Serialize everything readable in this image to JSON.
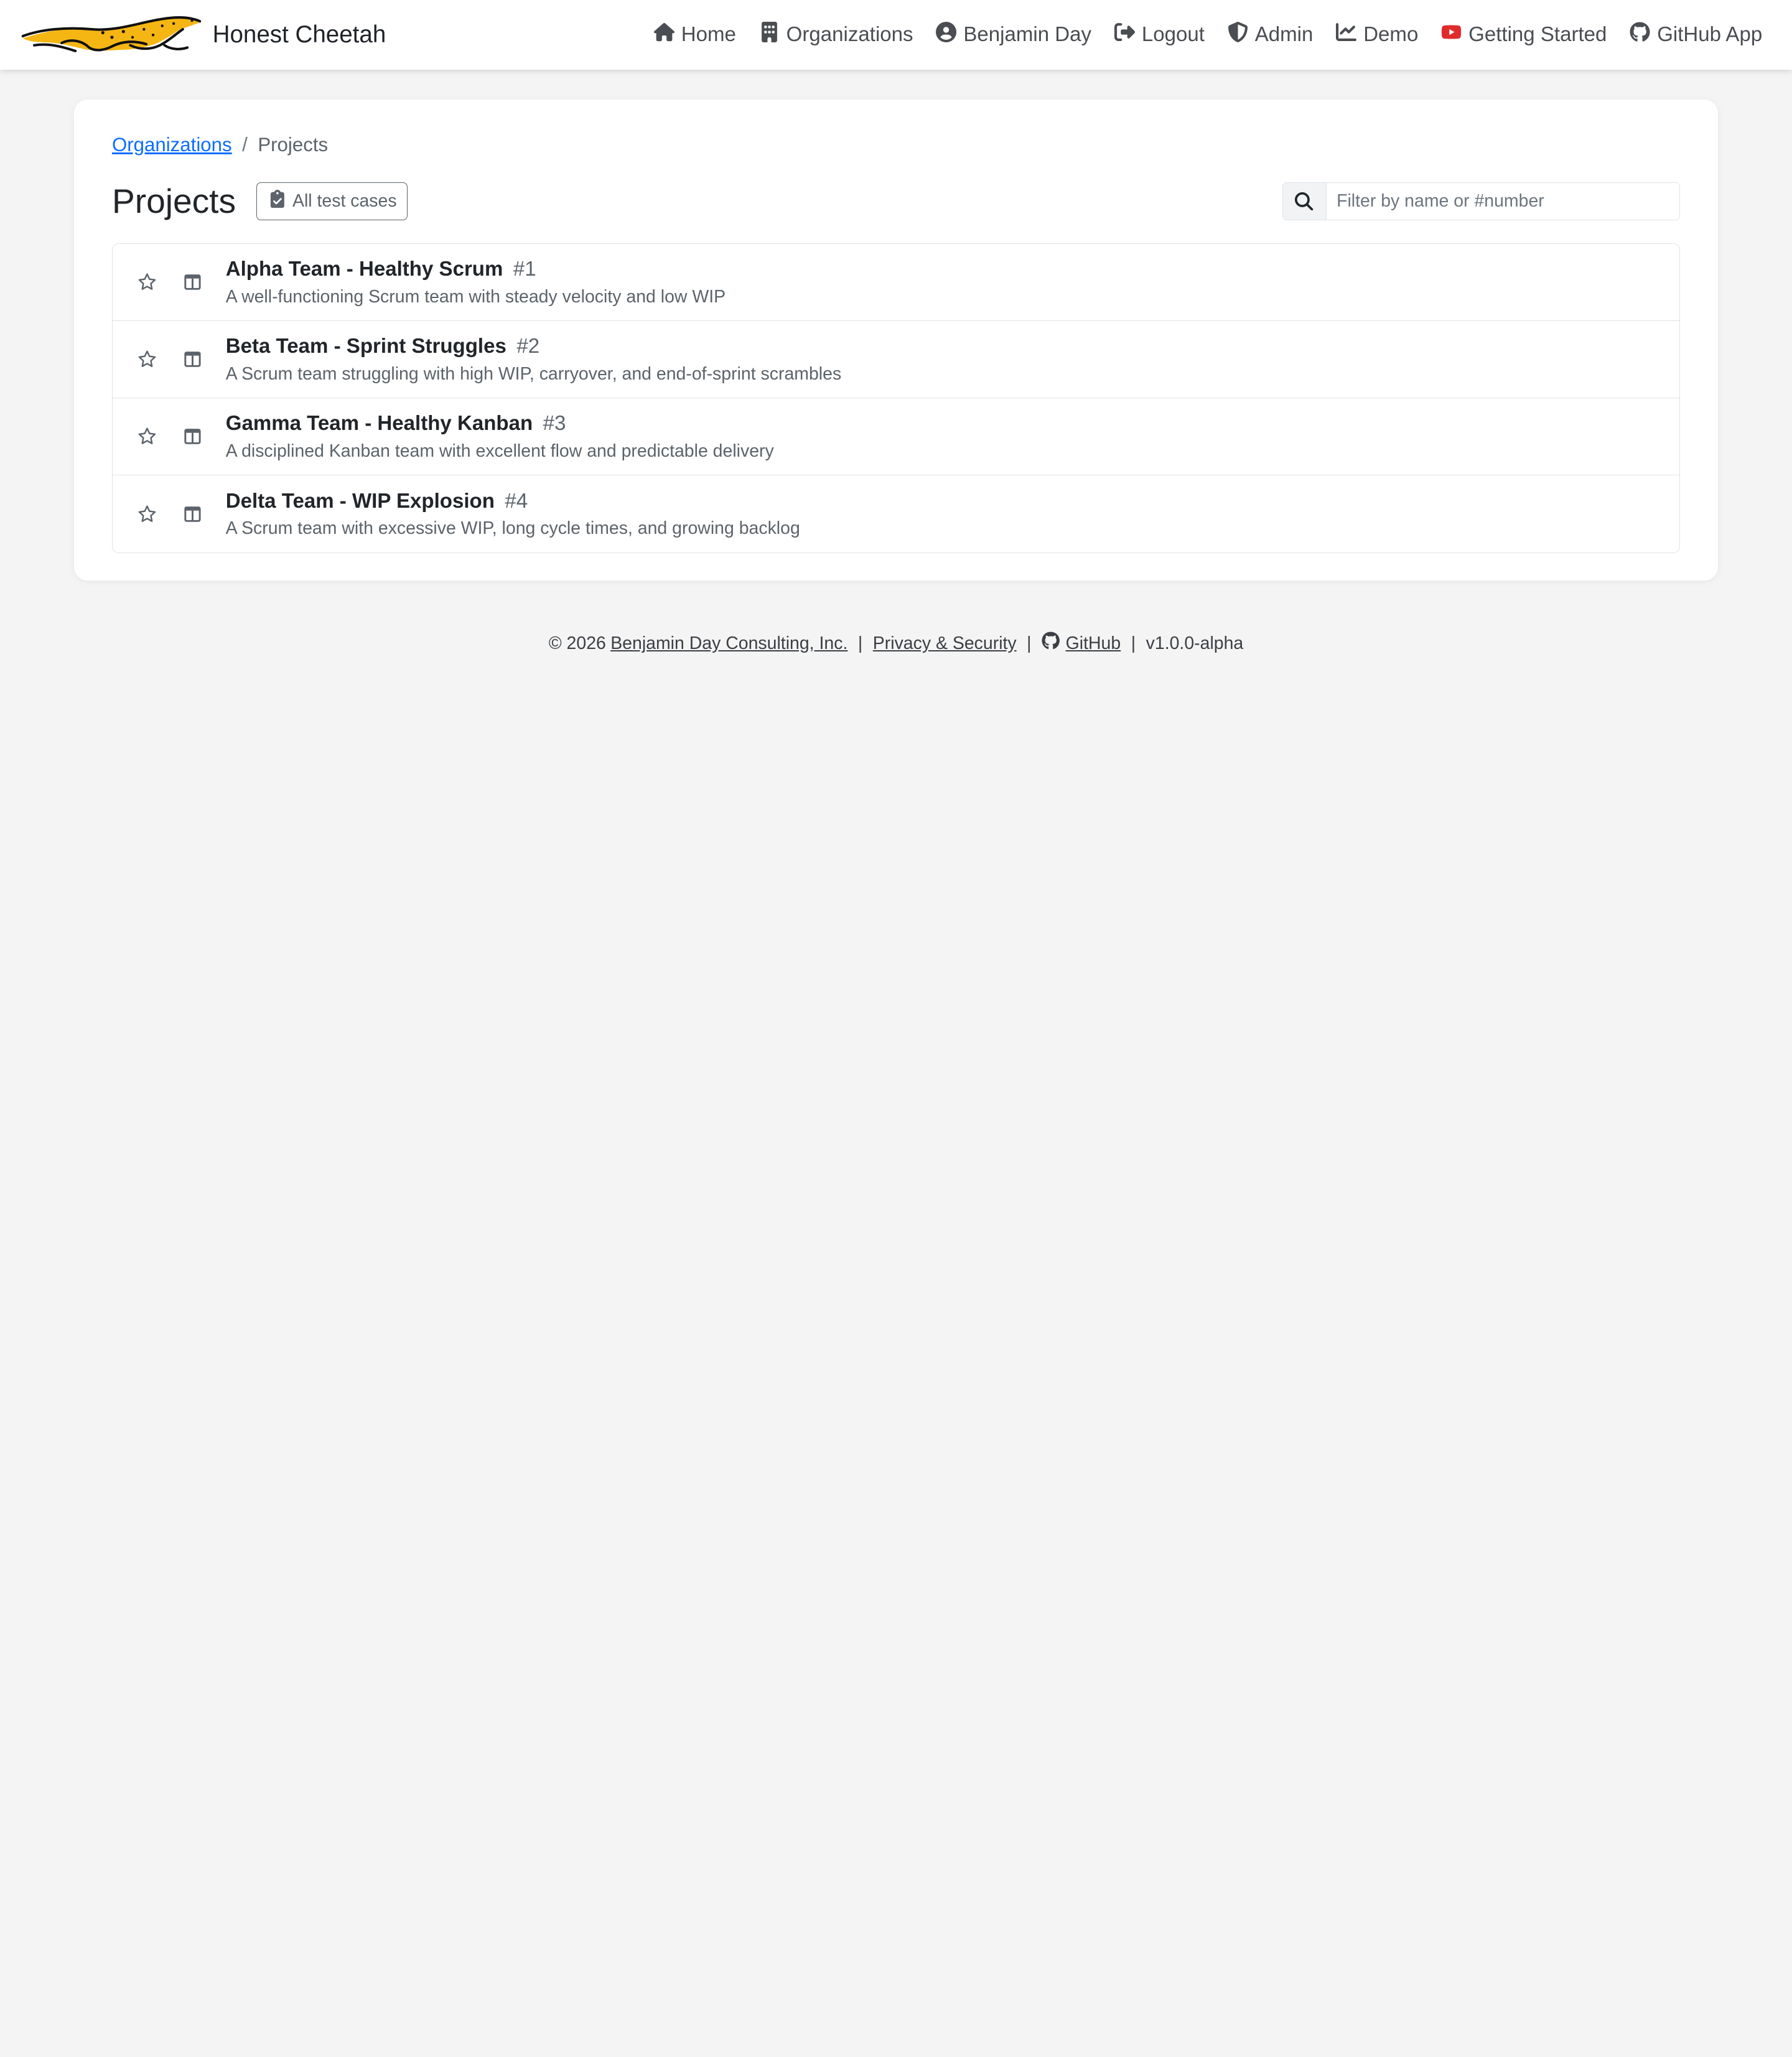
{
  "brand": {
    "name": "Honest Cheetah"
  },
  "nav": {
    "items": [
      {
        "label": "Home",
        "icon": "home-icon"
      },
      {
        "label": "Organizations",
        "icon": "building-icon"
      },
      {
        "label": "Benjamin Day",
        "icon": "user-circle-icon"
      },
      {
        "label": "Logout",
        "icon": "logout-icon"
      },
      {
        "label": "Admin",
        "icon": "shield-icon"
      },
      {
        "label": "Demo",
        "icon": "chart-line-icon"
      },
      {
        "label": "Getting Started",
        "icon": "youtube-icon"
      },
      {
        "label": "GitHub App",
        "icon": "github-icon"
      }
    ]
  },
  "breadcrumb": {
    "parent": "Organizations",
    "separator": "/",
    "current": "Projects"
  },
  "page": {
    "title": "Projects",
    "all_tests_label": "All test cases",
    "search_placeholder": "Filter by name or #number"
  },
  "projects": [
    {
      "name": "Alpha Team - Healthy Scrum",
      "number": "#1",
      "description": "A well-functioning Scrum team with steady velocity and low WIP"
    },
    {
      "name": "Beta Team - Sprint Struggles",
      "number": "#2",
      "description": "A Scrum team struggling with high WIP, carryover, and end-of-sprint scrambles"
    },
    {
      "name": "Gamma Team - Healthy Kanban",
      "number": "#3",
      "description": "A disciplined Kanban team with excellent flow and predictable delivery"
    },
    {
      "name": "Delta Team - WIP Explosion",
      "number": "#4",
      "description": "A Scrum team with excessive WIP, long cycle times, and growing backlog"
    }
  ],
  "footer": {
    "copyright": "© 2026",
    "company": "Benjamin Day Consulting, Inc.",
    "privacy": "Privacy & Security",
    "github": "GitHub",
    "version": "v1.0.0-alpha",
    "separator": "|"
  },
  "colors": {
    "link": "#0d6efd",
    "background": "#f4f4f4",
    "youtube": "#e02b2b",
    "logo_yellow": "#f5b614"
  }
}
